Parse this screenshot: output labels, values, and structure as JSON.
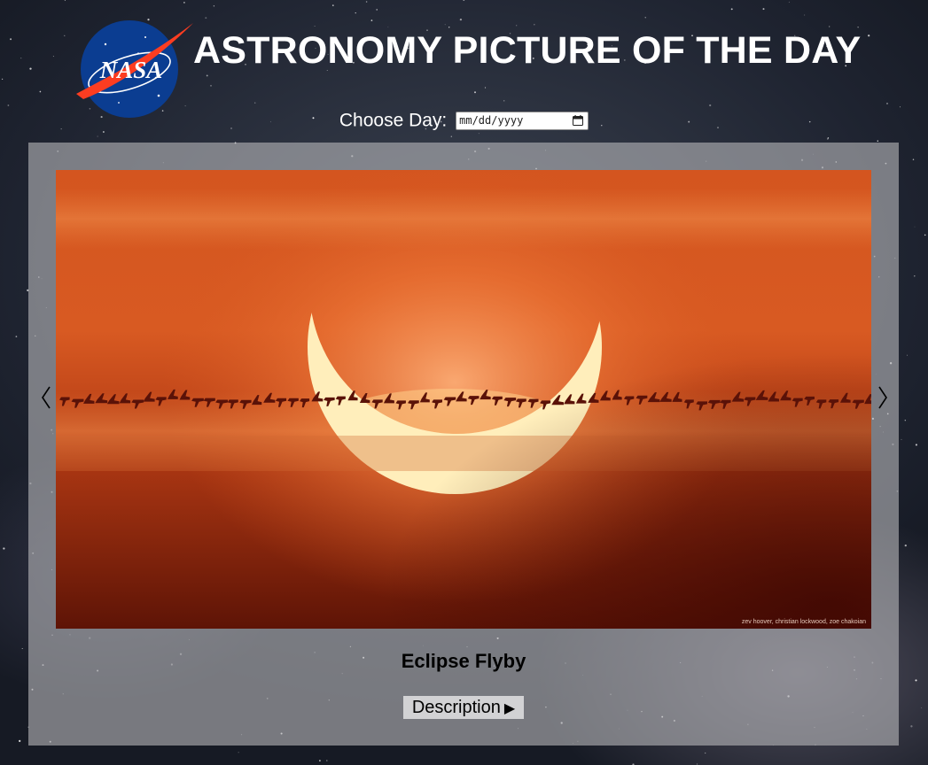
{
  "header": {
    "logo_text": "NASA",
    "title": "ASTRONOMY PICTURE OF THE DAY"
  },
  "date_picker": {
    "label": "Choose Day:",
    "value_placeholder": "mm/dd/yyyy",
    "icon": "calendar-icon"
  },
  "gallery": {
    "prev_icon": "chevron-left-icon",
    "next_icon": "chevron-right-icon",
    "image": {
      "title": "Eclipse Flyby",
      "credit": "zev hoover, christian lockwood, zoe chakoian"
    },
    "description_button": {
      "label": "Description",
      "icon": "triangle-right-icon"
    }
  },
  "colors": {
    "title_text": "#ffffff",
    "panel_bg": "#b4b4b8",
    "sky_orange": "#c23f13",
    "nasa_blue": "#0b3d91",
    "nasa_red": "#fc3d21"
  }
}
